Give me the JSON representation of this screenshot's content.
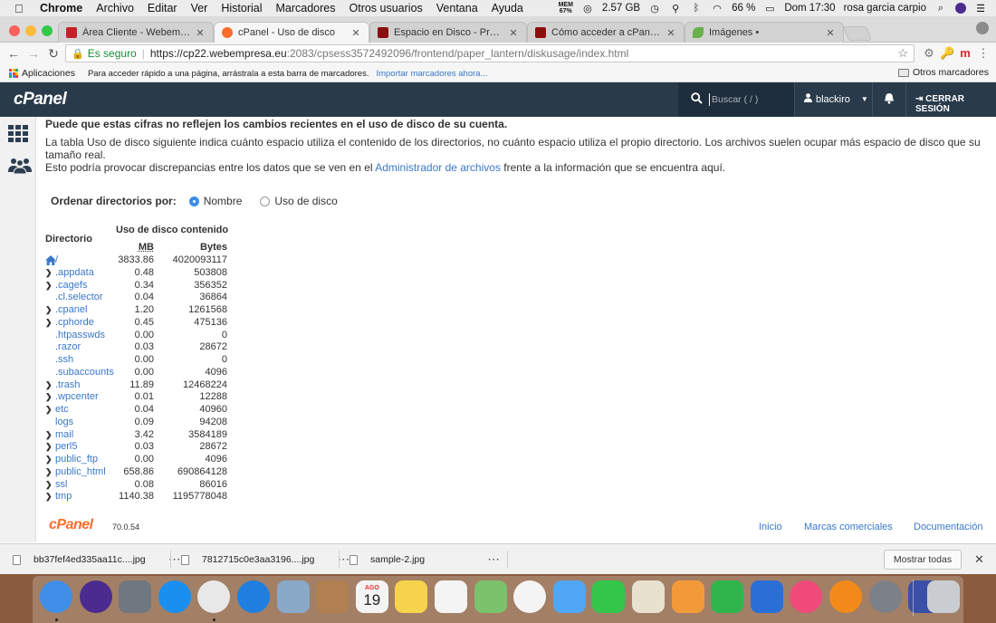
{
  "menubar": {
    "items": [
      "Chrome",
      "Archivo",
      "Editar",
      "Ver",
      "Historial",
      "Marcadores",
      "Otros usuarios",
      "Ventana",
      "Ayuda"
    ],
    "mem_label": "MEM",
    "mem_value": "67%",
    "memory": "2.57 GB",
    "battery": "66 %",
    "clock": "Dom 17:30",
    "user": "rosa garcia carpio"
  },
  "tabs": [
    {
      "label": "Área Cliente - Webempresa Eu",
      "active": false,
      "favicon_color": "#c8202a"
    },
    {
      "label": "cPanel - Uso de disco",
      "active": true,
      "favicon_color": "#ff6c2c"
    },
    {
      "label": "Espacio en Disco - Preguntas",
      "active": false,
      "favicon_color": "#8a1010"
    },
    {
      "label": "Cómo acceder a cPanel - Preg",
      "active": false,
      "favicon_color": "#8a1010"
    },
    {
      "label": "Imágenes •",
      "active": false,
      "favicon_color": "#6ab04c"
    }
  ],
  "address": {
    "secure_label": "Es seguro",
    "url_scheme": "https://",
    "url_host": "cp22.webempresa.eu",
    "url_rest": ":2083/cpsess3572492096/frontend/paper_lantern/diskusage/index.html"
  },
  "bookmarks": {
    "apps_label": "Aplicaciones",
    "hint": "Para acceder rápido a una página, arrástrala a esta barra de marcadores.",
    "import_link": "Importar marcadores ahora...",
    "other": "Otros marcadores"
  },
  "cpanel_header": {
    "logo": "cPanel",
    "search_placeholder": "Buscar ( / )",
    "username": "blackiro",
    "logout": "CERRAR SESIÓN"
  },
  "content": {
    "notice": "Puede que estas cifras no reflejen los cambios recientes en el uso de disco de su cuenta.",
    "desc_line1": "La tabla Uso de disco siguiente indica cuánto espacio utiliza el contenido de los directorios, no cuánto espacio utiliza el propio directorio. Los archivos suelen ocupar más espacio de disco que su tamaño real.",
    "desc_line2_a": "Esto podría provocar discrepancias entre los datos que se ven en el ",
    "desc_link": "Administrador de archivos",
    "desc_line2_b": " frente a la información que se encuentra aquí.",
    "sort_label": "Ordenar directorios por:",
    "sort_options": [
      {
        "label": "Nombre",
        "selected": true
      },
      {
        "label": "Uso de disco",
        "selected": false
      }
    ],
    "table": {
      "group_header": "Uso de disco contenido",
      "col_dir": "Directorio",
      "col_mb": "MB",
      "col_bytes": "Bytes",
      "rows": [
        {
          "name": "/",
          "mb": "3833.86",
          "bytes": "4020093117",
          "expandable": false,
          "home": true
        },
        {
          "name": ".appdata",
          "mb": "0.48",
          "bytes": "503808",
          "expandable": true
        },
        {
          "name": ".cagefs",
          "mb": "0.34",
          "bytes": "356352",
          "expandable": true
        },
        {
          "name": ".cl.selector",
          "mb": "0.04",
          "bytes": "36864",
          "expandable": false
        },
        {
          "name": ".cpanel",
          "mb": "1.20",
          "bytes": "1261568",
          "expandable": true
        },
        {
          "name": ".cphorde",
          "mb": "0.45",
          "bytes": "475136",
          "expandable": true
        },
        {
          "name": ".htpasswds",
          "mb": "0.00",
          "bytes": "0",
          "expandable": false
        },
        {
          "name": ".razor",
          "mb": "0.03",
          "bytes": "28672",
          "expandable": false
        },
        {
          "name": ".ssh",
          "mb": "0.00",
          "bytes": "0",
          "expandable": false
        },
        {
          "name": ".subaccounts",
          "mb": "0.00",
          "bytes": "4096",
          "expandable": false
        },
        {
          "name": ".trash",
          "mb": "11.89",
          "bytes": "12468224",
          "expandable": true
        },
        {
          "name": ".wpcenter",
          "mb": "0.01",
          "bytes": "12288",
          "expandable": true
        },
        {
          "name": "etc",
          "mb": "0.04",
          "bytes": "40960",
          "expandable": true
        },
        {
          "name": "logs",
          "mb": "0.09",
          "bytes": "94208",
          "expandable": false
        },
        {
          "name": "mail",
          "mb": "3.42",
          "bytes": "3584189",
          "expandable": true
        },
        {
          "name": "perl5",
          "mb": "0.03",
          "bytes": "28672",
          "expandable": true
        },
        {
          "name": "public_ftp",
          "mb": "0.00",
          "bytes": "4096",
          "expandable": true
        },
        {
          "name": "public_html",
          "mb": "658.86",
          "bytes": "690864128",
          "expandable": true
        },
        {
          "name": "ssl",
          "mb": "0.08",
          "bytes": "86016",
          "expandable": true
        },
        {
          "name": "tmp",
          "mb": "1140.38",
          "bytes": "1195778048",
          "expandable": true
        }
      ]
    }
  },
  "footer": {
    "logo": "cPanel",
    "version": "70.0.54",
    "links": [
      "Inicio",
      "Marcas comerciales",
      "Documentación"
    ]
  },
  "downloads": {
    "items": [
      "bb37fef4ed335aa11c....jpg",
      "7812715c0e3aa3196....jpg",
      "sample-2.jpg"
    ],
    "show_all": "Mostrar todas"
  },
  "dock": {
    "calendar_month": "AGO",
    "calendar_day": "19",
    "apps": [
      {
        "name": "finder",
        "color": "#3f8ee8"
      },
      {
        "name": "siri",
        "color": "#4a2b8f"
      },
      {
        "name": "launchpad",
        "color": "#6f7780"
      },
      {
        "name": "app-store",
        "color": "#1a8ff0"
      },
      {
        "name": "chrome",
        "color": "#e8e8e8"
      },
      {
        "name": "safari",
        "color": "#1f7fe0"
      },
      {
        "name": "preview-eagle",
        "color": "#8aa8c8"
      },
      {
        "name": "contacts",
        "color": "#b28152"
      },
      {
        "name": "calendar",
        "color": "#f4f4f4"
      },
      {
        "name": "notes",
        "color": "#f6d34a"
      },
      {
        "name": "reminders",
        "color": "#f4f4f4"
      },
      {
        "name": "maps",
        "color": "#7cc16b"
      },
      {
        "name": "photos",
        "color": "#f4f4f4"
      },
      {
        "name": "messages",
        "color": "#4fa7f5"
      },
      {
        "name": "facetime",
        "color": "#33c64b"
      },
      {
        "name": "textedit",
        "color": "#e8e1cf"
      },
      {
        "name": "sketch",
        "color": "#f29a3a"
      },
      {
        "name": "numbers",
        "color": "#2fb54b"
      },
      {
        "name": "keynote",
        "color": "#2b6fd6"
      },
      {
        "name": "itunes",
        "color": "#f04a7a"
      },
      {
        "name": "ibooks",
        "color": "#f28a1a"
      },
      {
        "name": "system-preferences",
        "color": "#7c8088"
      },
      {
        "name": "xcode-like",
        "color": "#3a4fa8"
      },
      {
        "name": "trash",
        "color": "#c9cdd2"
      }
    ]
  }
}
